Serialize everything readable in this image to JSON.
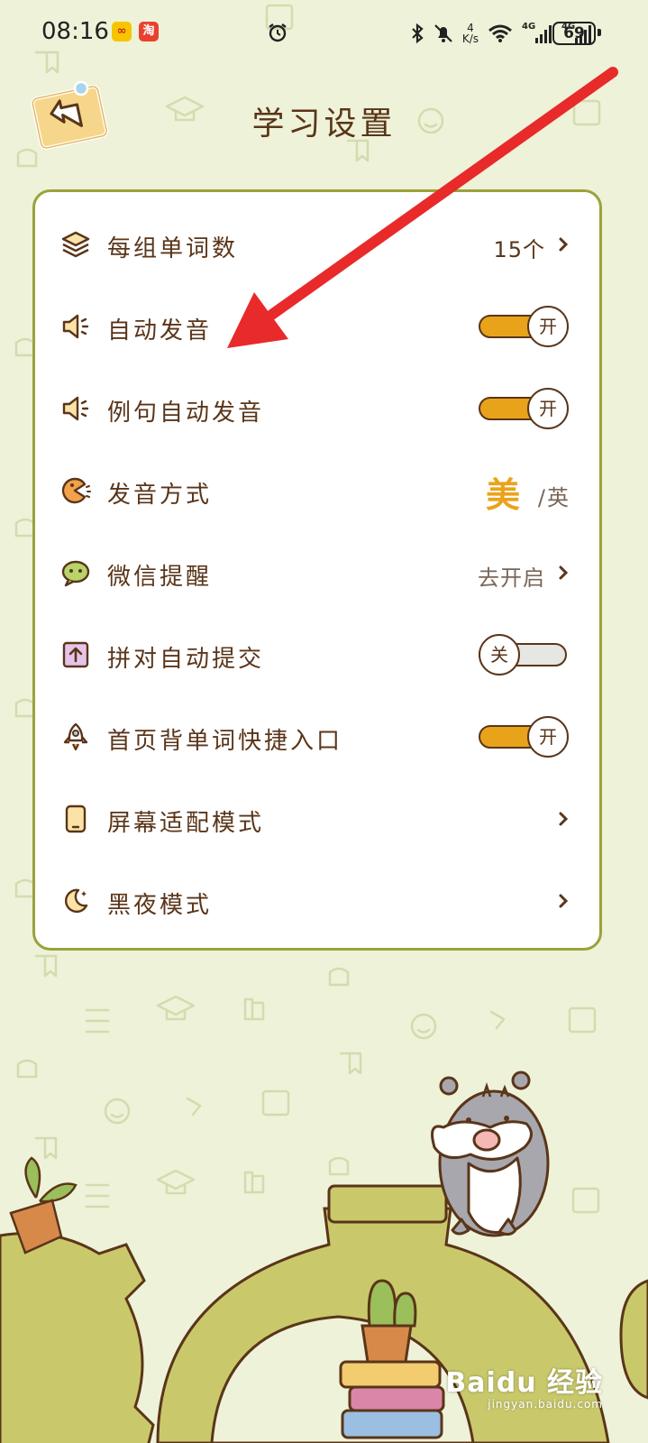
{
  "status_bar": {
    "time": "08:16",
    "app_badges": [
      "∞",
      "淘"
    ],
    "net_speed_value": "4",
    "net_speed_unit": "K/s",
    "signal_1": "4G",
    "signal_2": "4G",
    "battery": "69"
  },
  "header": {
    "title": "学习设置"
  },
  "settings": {
    "words_per_group": {
      "label": "每组单词数",
      "value": "15个"
    },
    "auto_pronounce": {
      "label": "自动发音",
      "state": "开"
    },
    "example_auto_pronounce": {
      "label": "例句自动发音",
      "state": "开"
    },
    "pronunciation_mode": {
      "label": "发音方式",
      "selected": "美",
      "other": "英"
    },
    "wechat_reminder": {
      "label": "微信提醒",
      "value": "去开启"
    },
    "pairing_auto_submit": {
      "label": "拼对自动提交",
      "state": "关"
    },
    "home_shortcut": {
      "label": "首页背单词快捷入口",
      "state": "开"
    },
    "screen_fit": {
      "label": "屏幕适配模式"
    },
    "dark_mode": {
      "label": "黑夜模式"
    }
  },
  "watermark": {
    "brand": "Baidu 经验",
    "url": "jingyan.baidu.com"
  },
  "colors": {
    "background": "#eef2d8",
    "card_border": "#9aa23c",
    "accent": "#e9a31b",
    "text": "#5a3519",
    "arrow": "#e82a2a"
  }
}
